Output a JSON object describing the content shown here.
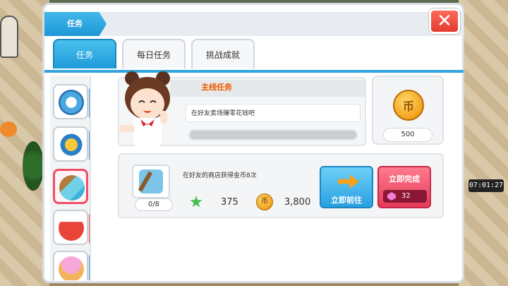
{
  "window": {
    "title": "任务",
    "close_icon": "close-icon"
  },
  "tabs": [
    {
      "label": "任务",
      "active": true
    },
    {
      "label": "每日任务",
      "active": false
    },
    {
      "label": "挑战成就",
      "active": false
    }
  ],
  "side_list": [
    {
      "icon": "search-tool-icon"
    },
    {
      "icon": "drone-icon"
    },
    {
      "icon": "broom-icon",
      "selected": true
    },
    {
      "icon": "drink-cup-icon"
    },
    {
      "icon": "ice-cream-icon"
    }
  ],
  "main_quest": {
    "title": "主线任务",
    "description": "在好友卖场赚零花钱吧",
    "progress": 0.0,
    "reward_amount": "500",
    "reward_icon": "gold-coin-icon"
  },
  "task": {
    "description": "在好友的商店获得金币8次",
    "count": "0/8",
    "exp_reward": "375",
    "gold_reward": "3,800",
    "goto_label": "立即前往",
    "finish_label": "立即完成",
    "finish_cost": "32"
  },
  "hud": {
    "clock": "07:01:27"
  },
  "colors": {
    "accent_blue": "#1e9ad8",
    "accent_red": "#e53c5a",
    "quest_title": "#e8571d"
  }
}
